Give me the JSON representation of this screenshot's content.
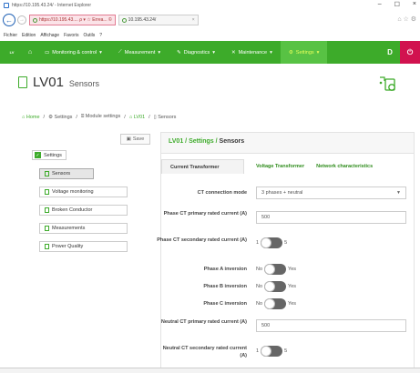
{
  "window": {
    "title": "https://10.195.43.24/ - Internet Explorer",
    "minimize": "–",
    "maximize": "☐",
    "close": "×"
  },
  "browser": {
    "address_tab": "https://10.195.43....  ρ ▾  ☆ Errea...  ©",
    "second_tab": "10.195.43.24/",
    "second_tab_close": "×",
    "icons": "⌂ ☆ ⚙"
  },
  "menubar": [
    "Fichier",
    "Edition",
    "Affichage",
    "Favoris",
    "Outils",
    "?"
  ],
  "nav": {
    "logo": "LV",
    "items": [
      {
        "label": "Monitoring & control",
        "icon": "monitor-icon"
      },
      {
        "label": "Measurement",
        "icon": "chart-icon"
      },
      {
        "label": "Diagnostics",
        "icon": "wrench-icon"
      },
      {
        "label": "Maintenance",
        "icon": "tools-icon"
      },
      {
        "label": "Settings",
        "icon": "gear-icon",
        "active": true
      }
    ],
    "user_btn": "D",
    "logout_btn": "⏻"
  },
  "page": {
    "title": "LV01",
    "subtitle": "Sensors"
  },
  "breadcrumb": {
    "home": "Home",
    "settings": "Settings",
    "module": "Module settings",
    "device": "LV01",
    "current": "Sensors",
    "sep": "/"
  },
  "left": {
    "save": "Save",
    "root": "Settings",
    "items": [
      {
        "label": "Sensors",
        "selected": true
      },
      {
        "label": "Voltage monitoring"
      },
      {
        "label": "Broken Conductor"
      },
      {
        "label": "Measurements"
      },
      {
        "label": "Power Quality"
      }
    ]
  },
  "right": {
    "breadcrumb_device": "LV01",
    "breadcrumb_settings": "Settings",
    "breadcrumb_leaf": "Sensors",
    "sep": " / ",
    "tabs": [
      "Current Transformer",
      "Voltage Transformer",
      "Network characteristics"
    ],
    "fields": {
      "ct_mode": {
        "label": "CT connection mode",
        "value": "3 phases + neutral"
      },
      "phase_primary": {
        "label": "Phase CT primary rated current (A)",
        "value": "500"
      },
      "phase_secondary": {
        "label": "Phase CT secondary rated current (A)",
        "left": "1",
        "right": "5"
      },
      "phase_a": {
        "label": "Phase A inversion",
        "left": "No",
        "right": "Yes"
      },
      "phase_b": {
        "label": "Phase B inversion",
        "left": "No",
        "right": "Yes"
      },
      "phase_c": {
        "label": "Phase C inversion",
        "left": "No",
        "right": "Yes"
      },
      "neutral_primary": {
        "label": "Neutral CT primary rated current (A)",
        "value": "500"
      },
      "neutral_secondary": {
        "label": "Neutral CT secondary rated current (A)",
        "left": "1",
        "right": "5"
      }
    }
  },
  "colors": {
    "accent": "#3dab2a",
    "logout": "#d1124f",
    "active_nav_text": "#e8ff5a"
  }
}
